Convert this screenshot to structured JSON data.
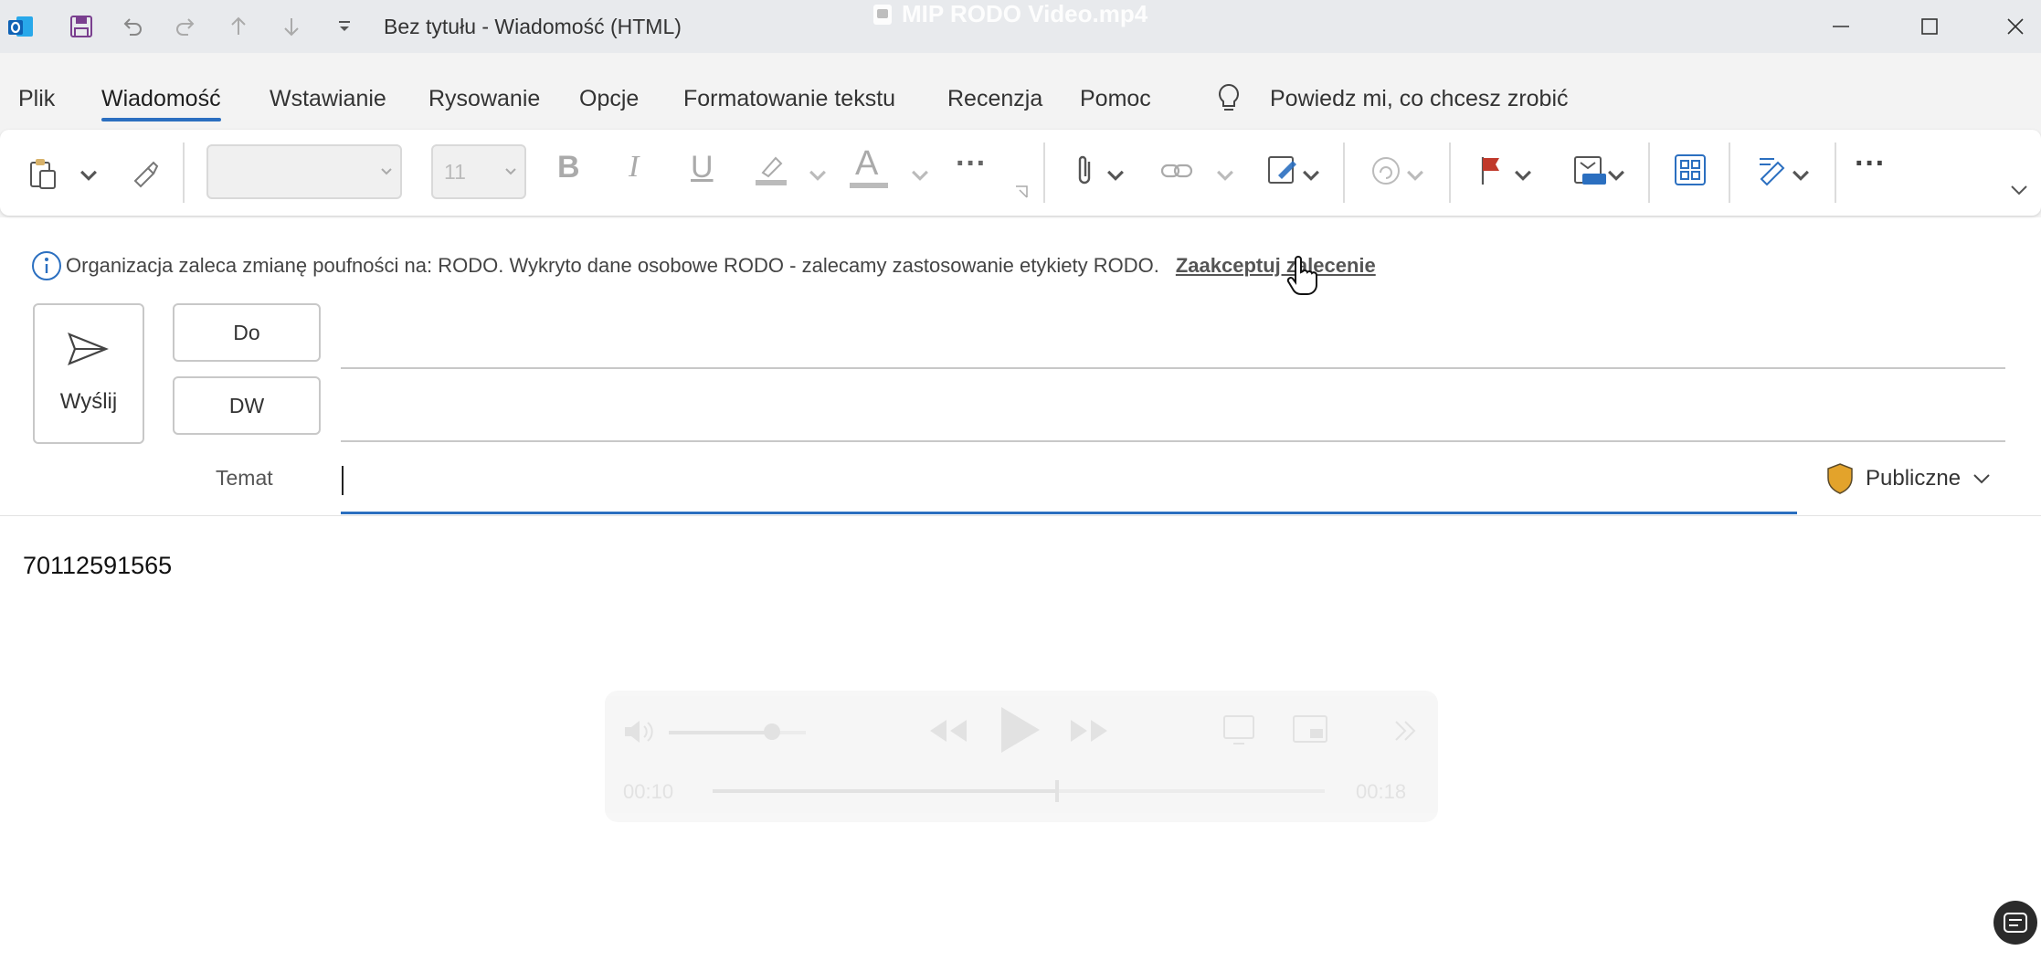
{
  "titlebar": {
    "window_title": "Bez tytułu  -  Wiadomość (HTML)",
    "video_title": "MIP RODO Video.mp4",
    "quick_access": [
      "outlook-logo-icon",
      "save-icon",
      "undo-icon",
      "redo-icon",
      "up-arrow-icon",
      "down-arrow-icon",
      "customize-quick-access-icon"
    ],
    "controls": [
      "minimize-icon",
      "maximize-icon",
      "close-icon"
    ]
  },
  "tabs": [
    {
      "label": "Plik"
    },
    {
      "label": "Wiadomość",
      "active": true
    },
    {
      "label": "Wstawianie"
    },
    {
      "label": "Rysowanie"
    },
    {
      "label": "Opcje"
    },
    {
      "label": "Formatowanie tekstu"
    },
    {
      "label": "Recenzja"
    },
    {
      "label": "Pomoc"
    }
  ],
  "tell_me": {
    "placeholder": "Powiedz mi, co chcesz zrobić",
    "icon": "lightbulb-icon"
  },
  "ribbon": {
    "font_name": "",
    "font_size": "11",
    "bold": "B",
    "italic": "I",
    "underline": "U",
    "font_color_glyph": "A",
    "more": "···",
    "overflow": "···",
    "accent": "#2b6fc0",
    "flag_color": "#c0392b"
  },
  "infobar": {
    "message": "Organizacja zaleca zmianę poufności na: RODO. Wykryto dane osobowe RODO - zalecamy zastosowanie etykiety RODO.",
    "action": "Zaakceptuj zalecenie"
  },
  "compose": {
    "send_label": "Wyślij",
    "to_label": "Do",
    "cc_label": "DW",
    "subject_label": "Temat",
    "subject_value": "",
    "sensitivity_label": "Publiczne",
    "sensitivity_color": "#e3a32b",
    "body_text": "70112591565"
  },
  "video_controls": {
    "elapsed": "00:10",
    "total": "00:18",
    "progress": 0.56,
    "volume": 0.75
  }
}
